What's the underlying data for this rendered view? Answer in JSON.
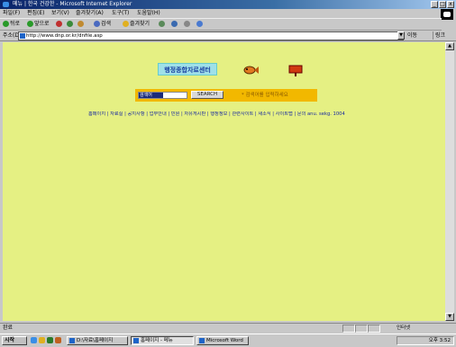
{
  "window": {
    "title": "메뉴 | 한국 건강한 - Microsoft Internet Explorer",
    "controls": [
      "_",
      "□",
      "x"
    ]
  },
  "menubar": {
    "items": [
      "파일(F)",
      "편집(E)",
      "보기(V)",
      "즐겨찾기(A)",
      "도구(T)",
      "도움말(H)"
    ]
  },
  "toolbar": {
    "items": [
      "뒤로",
      "앞으로",
      "중지",
      "새로고침",
      "홈",
      "검색",
      "즐겨찾기",
      "기록",
      "메일",
      "인쇄",
      "편집"
    ]
  },
  "address": {
    "label": "주소(D)",
    "url": "http://www.dnp.or.kr/dnfile.asp",
    "go_label": "이동",
    "links_label": "링크"
  },
  "page": {
    "logo_text": "행정종합자료센터",
    "search": {
      "selected_text": "검색어",
      "button_label": "SEARCH",
      "hint": "* 검색어를 입력하세요"
    },
    "nav_links": "홈페이지 | 자료실 | 공지사항 | 업무안내 | 민원 | 자유게시판 | 행정정보 | 관련사이트 | 새소식 | 사이트맵 | 문의 anu. sekg. 1004"
  },
  "statusbar": {
    "status_text": "완료",
    "zone_text": "인터넷"
  },
  "taskbar": {
    "start_label": "시작",
    "tasks": [
      {
        "label": "D:\\자료\\홈페이지",
        "active": false
      },
      {
        "label": "홈페이지 - 메뉴",
        "active": true
      },
      {
        "label": "Microsoft Word",
        "active": false
      }
    ],
    "tray_time": "오후 3:52"
  },
  "colors": {
    "page_background": "#e5f083",
    "search_bar": "#f2b800",
    "title_gradient_start": "#0a246a",
    "link_color": "#1a2aa0"
  },
  "icons": {
    "fish": "fish-icon",
    "book": "book-icon",
    "ie": "internet-explorer-icon"
  }
}
